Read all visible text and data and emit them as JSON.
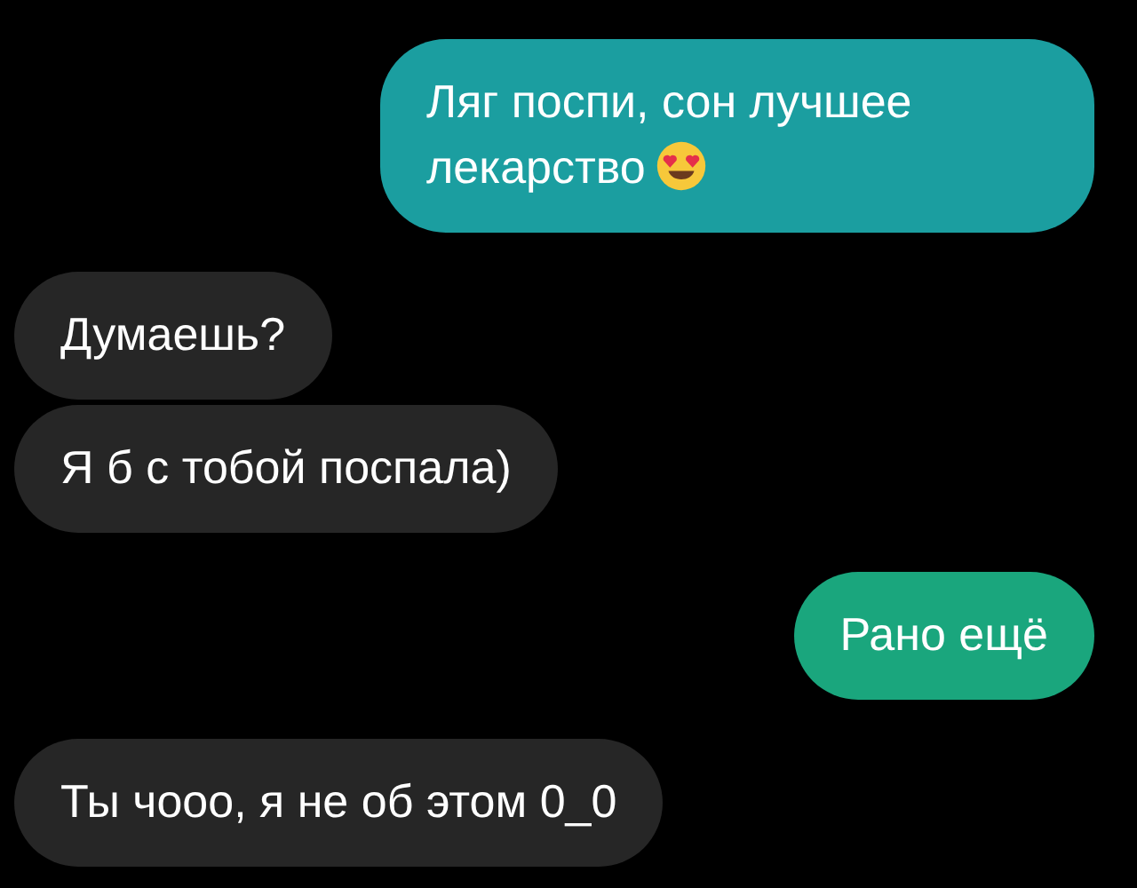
{
  "messages": [
    {
      "text": "Ляг поспи, сон лучшее лекарство",
      "outgoing": true,
      "color": "#1b9ea0",
      "has_emoji": true
    },
    {
      "text": "Думаешь?",
      "outgoing": false,
      "color": "#262626",
      "has_emoji": false
    },
    {
      "text": "Я б с тобой поспала)",
      "outgoing": false,
      "color": "#262626",
      "has_emoji": false
    },
    {
      "text": "Рано ещё",
      "outgoing": true,
      "color": "#1aa67d",
      "has_emoji": false
    },
    {
      "text": "Ты чооо, я не об этом 0_0",
      "outgoing": false,
      "color": "#262626",
      "has_emoji": false
    }
  ]
}
